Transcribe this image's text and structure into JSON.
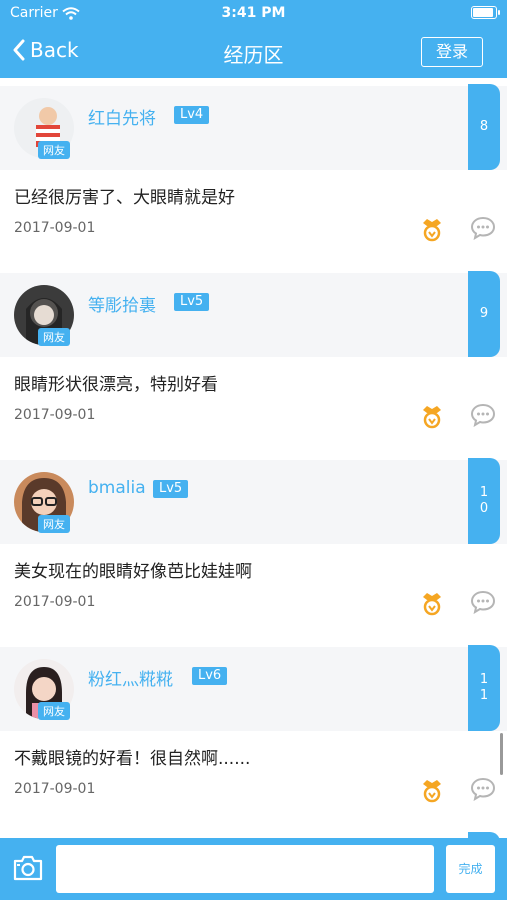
{
  "status_bar": {
    "carrier": "Carrier",
    "time": "3:41 PM"
  },
  "nav": {
    "back_label": "Back",
    "title": "经历区",
    "login_label": "登录"
  },
  "colors": {
    "accent": "#45b1f0",
    "medal": "#f5a623"
  },
  "posts": [
    {
      "username": "红白先将",
      "level": "Lv4",
      "tag": "网友",
      "floor": "8",
      "content": "已经很厉害了、大眼睛就是好",
      "date": "2017-09-01"
    },
    {
      "username": "等彫拾裏",
      "level": "Lv5",
      "tag": "网友",
      "floor": "9",
      "content": "眼睛形状很漂亮，特别好看",
      "date": "2017-09-01"
    },
    {
      "username": "bmalia",
      "level": "Lv5",
      "tag": "网友",
      "floor": "10",
      "content": "美女现在的眼睛好像芭比娃娃啊",
      "date": "2017-09-01"
    },
    {
      "username": "粉红灬糀糀",
      "level": "Lv6",
      "tag": "网友",
      "floor": "11",
      "content": "不戴眼镜的好看！很自然啊......",
      "date": "2017-09-01"
    }
  ],
  "composer": {
    "done_label": "完成"
  },
  "icons": {
    "camera": "camera-icon",
    "medal": "medal-icon",
    "comment": "comment-icon",
    "back": "chevron-left-icon",
    "wifi": "wifi-icon",
    "battery": "battery-icon"
  }
}
